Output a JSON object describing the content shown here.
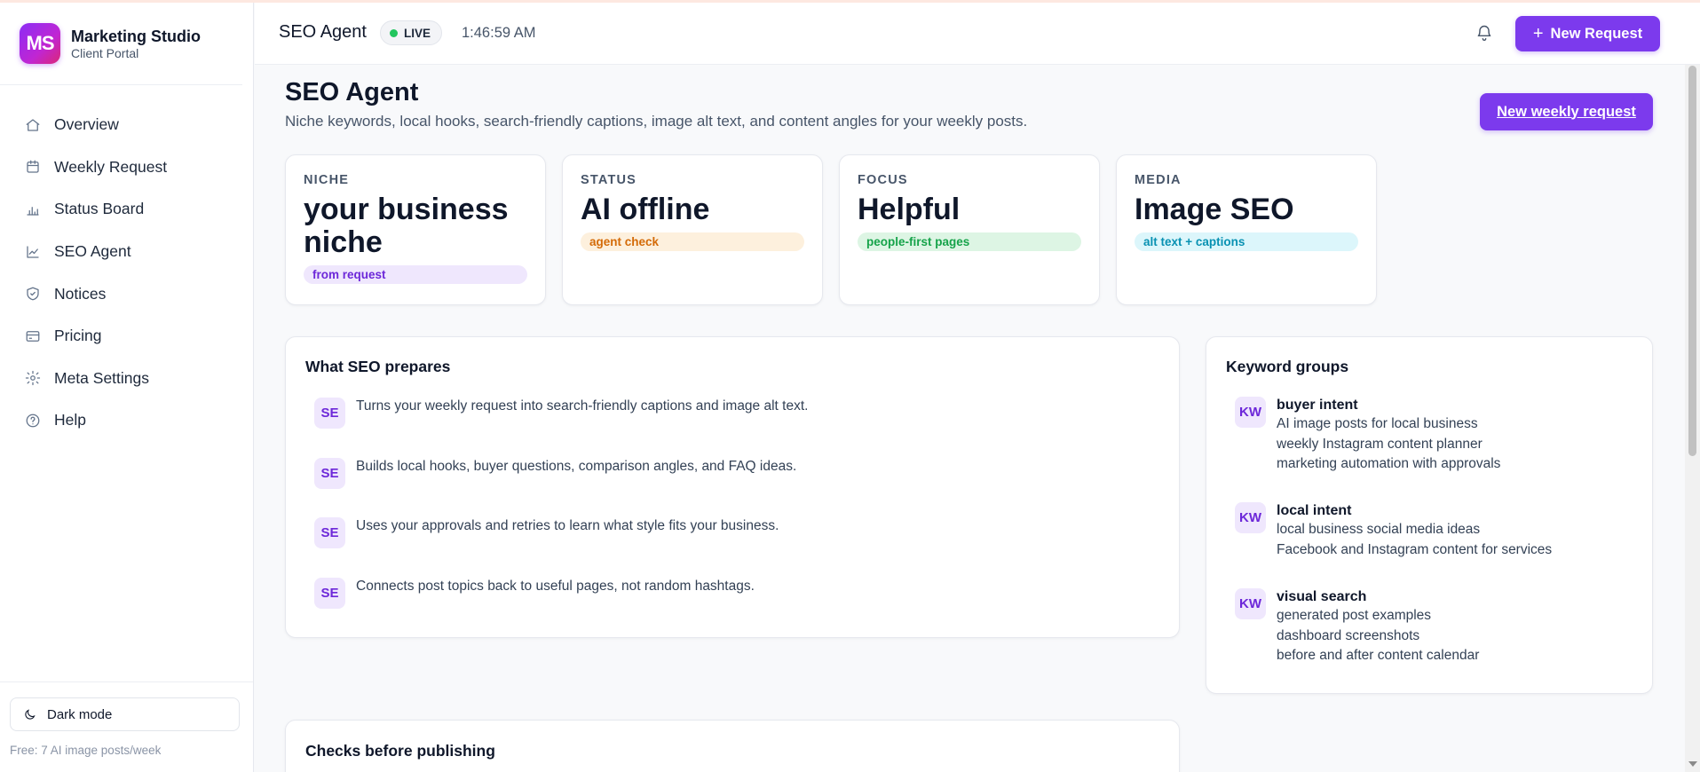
{
  "brand": {
    "logo": "MS",
    "title": "Marketing Studio",
    "subtitle": "Client Portal"
  },
  "sidebar": {
    "items": [
      {
        "label": "Overview",
        "icon": "home-icon"
      },
      {
        "label": "Weekly Request",
        "icon": "calendar-icon"
      },
      {
        "label": "Status Board",
        "icon": "bar-chart-icon"
      },
      {
        "label": "SEO Agent",
        "icon": "line-chart-icon"
      },
      {
        "label": "Notices",
        "icon": "shield-icon"
      },
      {
        "label": "Pricing",
        "icon": "credit-card-icon"
      },
      {
        "label": "Meta Settings",
        "icon": "gear-icon"
      },
      {
        "label": "Help",
        "icon": "help-circle-icon"
      }
    ],
    "dark_mode_label": "Dark mode",
    "plan_text": "Free: 7 AI image posts/week"
  },
  "header": {
    "title": "SEO Agent",
    "live_label": "LIVE",
    "time": "1:46:59 AM",
    "new_request_label": "New Request"
  },
  "main": {
    "title": "SEO Agent",
    "subtitle": "Niche keywords, local hooks, search-friendly captions, image alt text, and content angles for your weekly posts.",
    "weekly_button_label": "New weekly request",
    "stats": [
      {
        "key": "NICHE",
        "value": "your business niche",
        "pill": "from request"
      },
      {
        "key": "STATUS",
        "value": "AI offline",
        "pill": "agent check"
      },
      {
        "key": "FOCUS",
        "value": "Helpful",
        "pill": "people-first pages"
      },
      {
        "key": "MEDIA",
        "value": "Image SEO",
        "pill": "alt text + captions"
      }
    ],
    "prepares": {
      "title": "What SEO prepares",
      "badge": "SE",
      "items": [
        "Turns your weekly request into search-friendly captions and image alt text.",
        "Builds local hooks, buyer questions, comparison angles, and FAQ ideas.",
        "Uses your approvals and retries to learn what style fits your business.",
        "Connects post topics back to useful pages, not random hashtags."
      ]
    },
    "keywords": {
      "title": "Keyword groups",
      "badge": "KW",
      "groups": [
        {
          "name": "buyer intent",
          "lines": [
            "AI image posts for local business",
            "weekly Instagram content planner",
            "marketing automation with approvals"
          ]
        },
        {
          "name": "local intent",
          "lines": [
            "local business social media ideas",
            "Facebook and Instagram content for services"
          ]
        },
        {
          "name": "visual search",
          "lines": [
            "generated post examples",
            "dashboard screenshots",
            "before and after content calendar"
          ]
        }
      ]
    },
    "checks": {
      "title": "Checks before publishing"
    }
  },
  "colors": {
    "accent": "#7c3aed",
    "live_dot": "#22c55e"
  }
}
